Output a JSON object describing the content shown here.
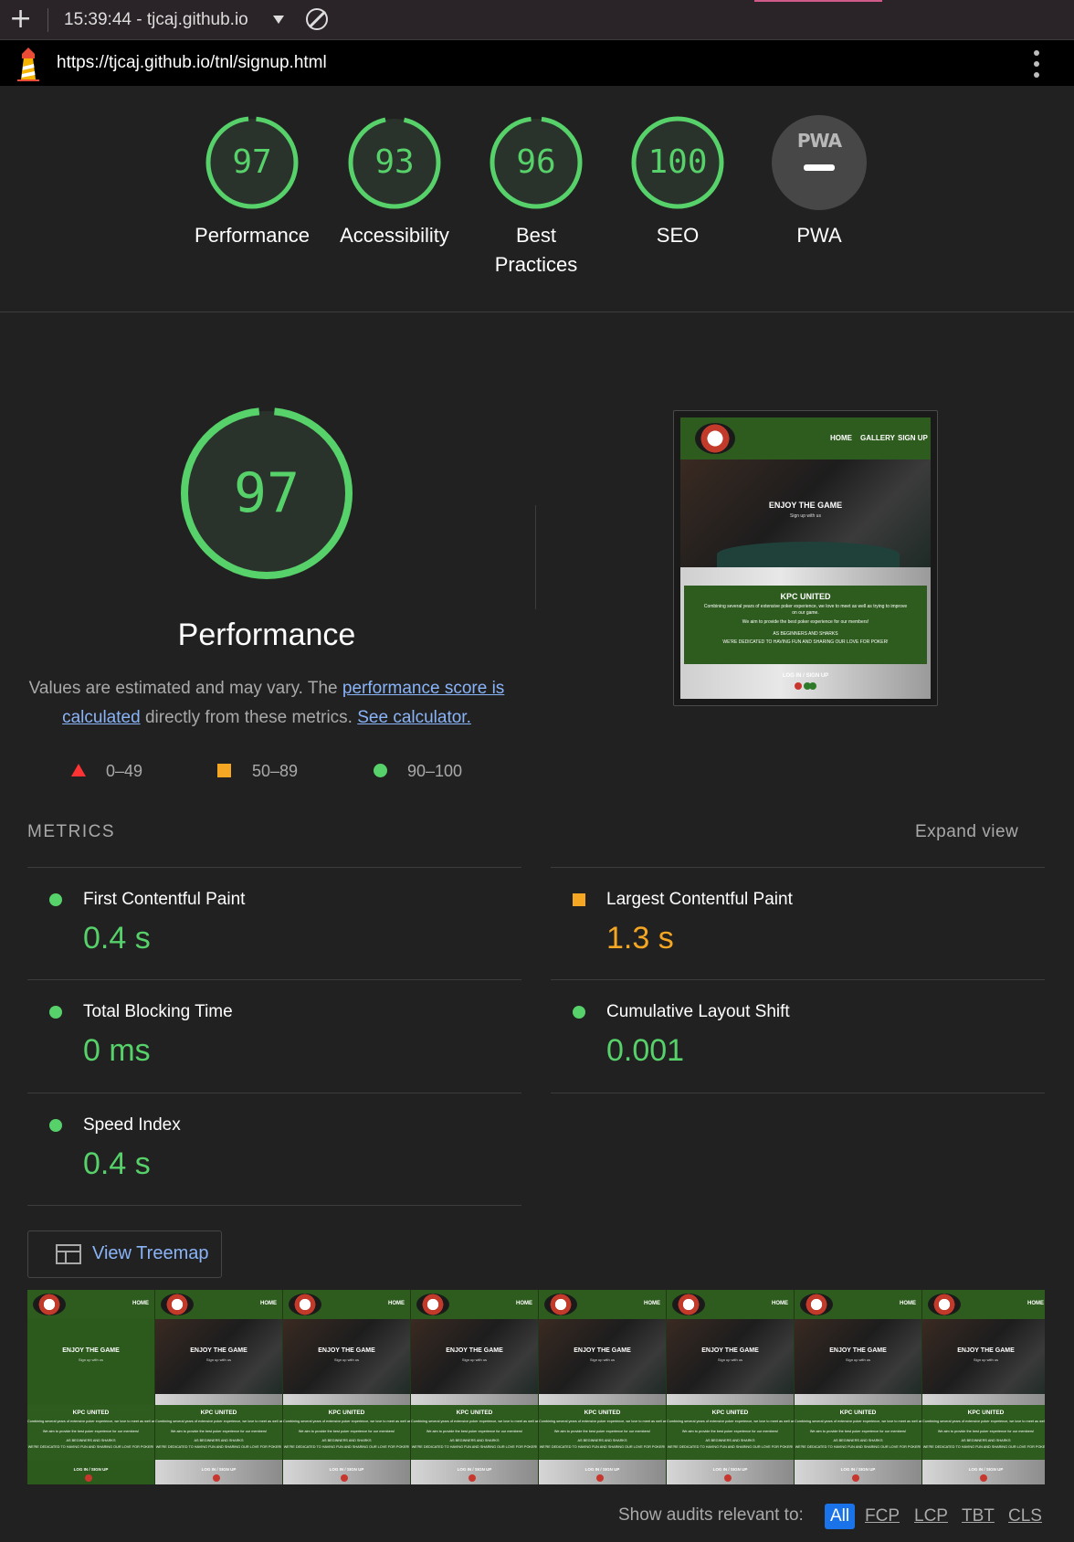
{
  "browser": {
    "report_title": "15:39:44 - tjcaj.github.io",
    "url": "https://tjcaj.github.io/tnl/signup.html"
  },
  "categories": [
    {
      "label": "Performance",
      "score": "97",
      "fraction": 0.97
    },
    {
      "label": "Accessibility",
      "score": "93",
      "fraction": 0.93
    },
    {
      "label": "Best Practices",
      "score": "96",
      "fraction": 0.96
    },
    {
      "label": "SEO",
      "score": "100",
      "fraction": 1.0
    },
    {
      "label": "PWA",
      "badge": "PWA"
    }
  ],
  "performance": {
    "score": "97",
    "fraction": 0.97,
    "title": "Performance",
    "desc_prefix": "Values are estimated and may vary. The ",
    "desc_link": "performance score is calculated",
    "desc_middle": " directly from these metrics. ",
    "desc_calc_link": "See calculator.",
    "legend": {
      "fail": "0–49",
      "average": "50–89",
      "pass": "90–100"
    }
  },
  "site_preview": {
    "nav": [
      "HOME",
      "GALLERY",
      "SIGN UP"
    ],
    "hero_title": "ENJOY THE GAME",
    "hero_sub": "Sign up with us",
    "box_title": "KPC UNITED",
    "box_lines": [
      "Combining several years of extensive poker experience, we love to meet as well as trying to improve",
      "on our game.",
      "We aim to provide the best poker experience for our members!",
      "AS BEGINNERS AND SHARKS",
      "WE'RE DEDICATED TO HAVING FUN AND SHARING OUR LOVE FOR POKER!"
    ],
    "login": "LOG IN / SIGN UP"
  },
  "metrics": {
    "heading": "METRICS",
    "expand_label": "Expand view",
    "items": [
      {
        "name": "First Contentful Paint",
        "value": "0.4 s",
        "rating": "pass"
      },
      {
        "name": "Largest Contentful Paint",
        "value": "1.3 s",
        "rating": "average"
      },
      {
        "name": "Total Blocking Time",
        "value": "0 ms",
        "rating": "pass"
      },
      {
        "name": "Cumulative Layout Shift",
        "value": "0.001",
        "rating": "pass"
      },
      {
        "name": "Speed Index",
        "value": "0.4 s",
        "rating": "pass"
      }
    ]
  },
  "treemap_button": "View Treemap",
  "filmstrip": {
    "frame_count": 8,
    "home_label": "HOME"
  },
  "audit_filter": {
    "label": "Show audits relevant to:",
    "chips": [
      "All",
      "FCP",
      "LCP",
      "TBT",
      "CLS"
    ],
    "active": "All"
  },
  "colors": {
    "pass": "#57d16a",
    "average": "#f5a623",
    "fail": "#f33",
    "accent_link": "#8ab4f8",
    "chip_active": "#1a73e8"
  }
}
